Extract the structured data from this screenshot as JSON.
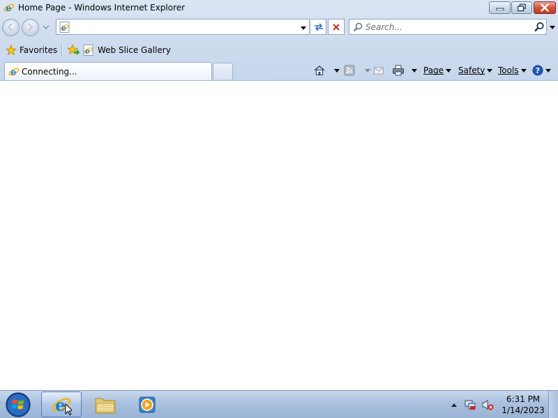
{
  "window": {
    "title": "Home Page - Windows Internet Explorer"
  },
  "address_bar": {
    "value": "",
    "placeholder": ""
  },
  "search": {
    "placeholder": "Search..."
  },
  "favorites_bar": {
    "favorites_label": "Favorites",
    "items": [
      {
        "label": "Web Slice Gallery"
      }
    ]
  },
  "tabs": {
    "active_label": "Connecting..."
  },
  "command_bar": {
    "page_label": "Page",
    "safety_label": "Safety",
    "tools_label": "Tools"
  },
  "taskbar": {
    "clock_time": "6:31 PM",
    "clock_date": "1/14/2023"
  },
  "colors": {
    "chrome_blue": "#cfdcee",
    "close_red": "#c23a22",
    "ie_blue": "#1e7fd4",
    "taskbar_blue": "#a9c0de"
  },
  "icons": {
    "window": "ie-logo-icon",
    "start": "windows-logo-icon",
    "tray": [
      "network-icon",
      "volume-muted-icon"
    ]
  }
}
